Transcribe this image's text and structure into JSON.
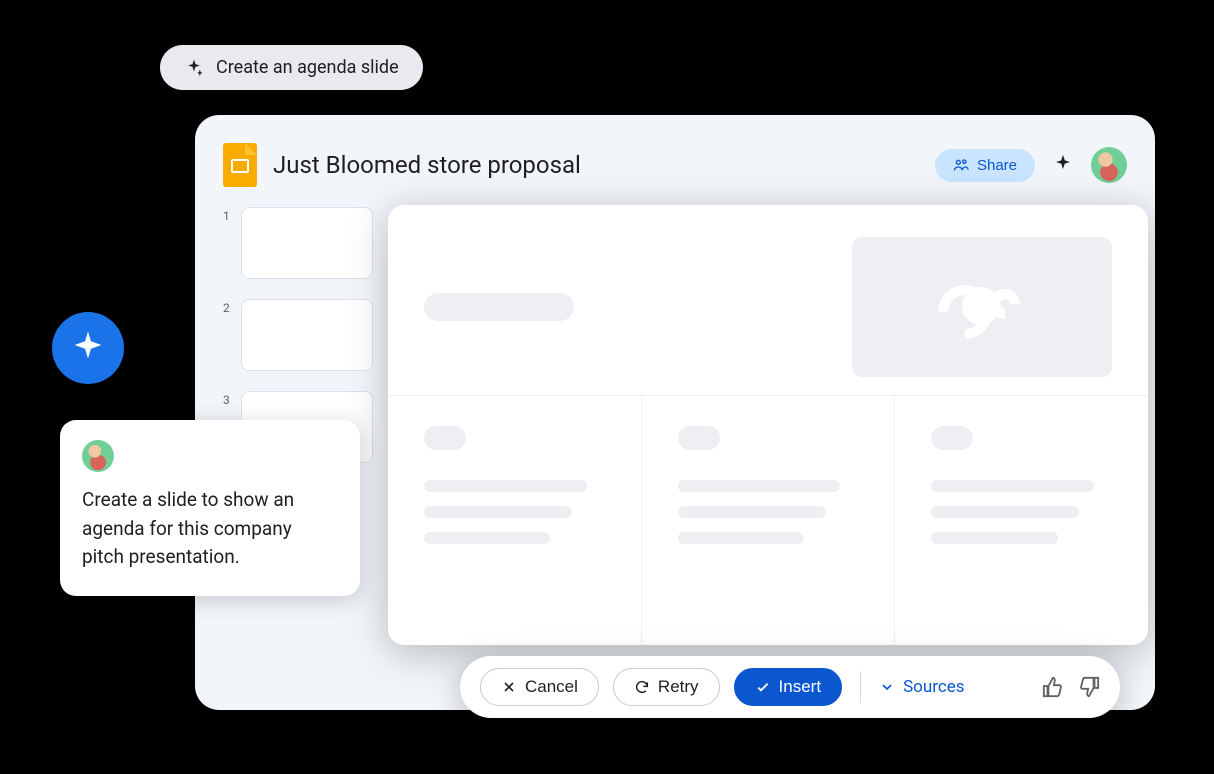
{
  "chip": {
    "label": "Create an agenda slide"
  },
  "header": {
    "title": "Just Bloomed store proposal",
    "share_label": "Share"
  },
  "thumbs": [
    {
      "n": "1"
    },
    {
      "n": "2"
    },
    {
      "n": "3"
    }
  ],
  "actions": {
    "cancel": "Cancel",
    "retry": "Retry",
    "insert": "Insert",
    "sources": "Sources"
  },
  "prompt": {
    "text": "Create a slide to show an agenda for this company pitch presentation."
  }
}
